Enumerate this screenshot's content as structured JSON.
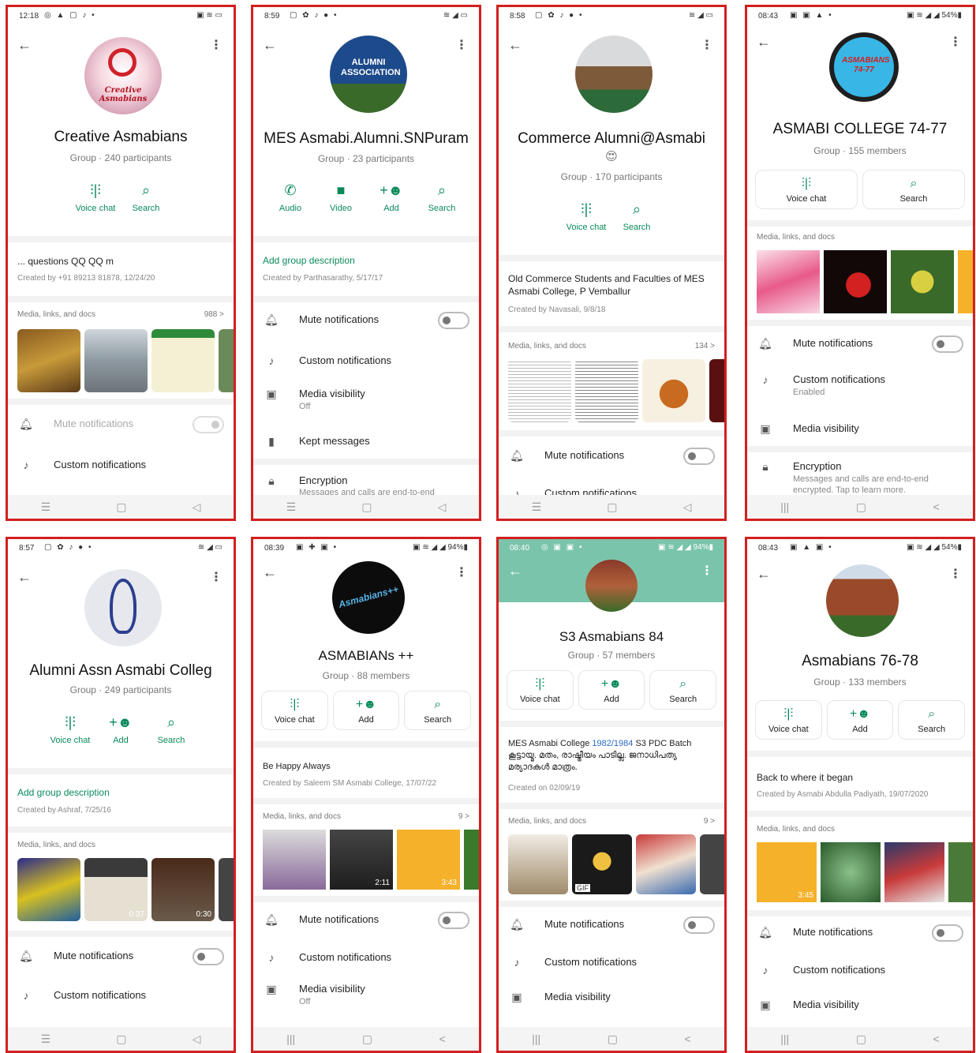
{
  "colors": {
    "accent": "#0a8a5a",
    "frame": "#d31f1f",
    "teal_header": "#7bc4ac"
  },
  "nav": {
    "menu": "☰",
    "home": "▢",
    "back": "◁",
    "recents": "|||",
    "back_alt": "<"
  },
  "p1": {
    "status": {
      "time": "12:18",
      "icons": "◎ ▲ ▢ ♪ •",
      "right": "▣ ≋ ▭"
    },
    "name": "Creative Asmabians",
    "sub": "Group · 240 participants",
    "avatar_text": "Creative Asmabians",
    "act1": "Voice chat",
    "act2": "Search",
    "desc": "... questions QQ QQ m",
    "created": "Created by +91 89213 81878, 12/24/20",
    "media": "Media, links, and docs",
    "count": "988 >",
    "mute": "Mute notifications",
    "custom": "Custom notifications"
  },
  "p2": {
    "status": {
      "time": "8:59",
      "icons": "▢ ✿ ♪ ● •",
      "right": "≋ ◢ ▭"
    },
    "name": "MES Asmabi.Alumni.SNPuram",
    "sub": "Group · 23 participants",
    "avatar_text": "ALUMNI ASSOCIATION",
    "act1": "Audio",
    "act2": "Video",
    "act3": "Add",
    "act4": "Search",
    "adddesc": "Add group description",
    "created": "Created by Parthasarathy, 5/17/17",
    "mute": "Mute notifications",
    "custom": "Custom notifications",
    "mediavis": "Media visibility",
    "off": "Off",
    "kept": "Kept messages",
    "enc": "Encryption",
    "enc_sub": "Messages and calls are end-to-end"
  },
  "p3": {
    "status": {
      "time": "8:58",
      "icons": "▢ ✿ ♪ ● •",
      "right": "≋ ◢ ▭"
    },
    "name": "Commerce Alumni@Asmabi",
    "emoji": "😍",
    "sub": "Group · 170 participants",
    "act1": "Voice chat",
    "act2": "Search",
    "desc": "Old Commerce Students and Faculties of MES Asmabi College, P Vemballur",
    "created": "Created by Navasali, 9/8/18",
    "media": "Media, links, and docs",
    "count": "134 >",
    "mute": "Mute notifications",
    "custom": "Custom notifications"
  },
  "p4": {
    "status": {
      "time": "08:43",
      "icons": "▣ ▣ ▲ •",
      "right": "▣ ≋ ◢ ◢ 54%▮"
    },
    "name": "ASMABI COLLEGE 74-77",
    "sub": "Group · 155 members",
    "avatar_text": "ASMABIANS 74-77",
    "act1": "Voice chat",
    "act2": "Search",
    "media": "Media, links, and docs",
    "mute": "Mute notifications",
    "custom": "Custom notifications",
    "enabled": "Enabled",
    "mediavis": "Media visibility",
    "enc": "Encryption",
    "enc_sub": "Messages and calls are end-to-end encrypted. Tap to learn more."
  },
  "p5": {
    "status": {
      "time": "8:57",
      "icons": "▢ ✿ ♪ ● •",
      "right": "≋ ◢ ▭"
    },
    "name": "Alumni Assn Asmabi Colleg",
    "sub": "Group · 249 participants",
    "act1": "Voice chat",
    "act2": "Add",
    "act3": "Search",
    "adddesc": "Add group description",
    "created": "Created by Ashraf, 7/25/16",
    "media": "Media, links, and docs",
    "dur1": "0:37",
    "dur2": "0:30",
    "mute": "Mute notifications",
    "custom": "Custom notifications"
  },
  "p6": {
    "status": {
      "time": "08:39",
      "icons": "▣ ✚ ▣ •",
      "right": "▣ ≋ ◢ ◢ 94%▮"
    },
    "name": "ASMABIANs ++",
    "sub": "Group · 88 members",
    "avatar_text": "Asmabians++",
    "act1": "Voice chat",
    "act2": "Add",
    "act3": "Search",
    "desc": "Be Happy Always",
    "created": "Created by Saleem SM Asmabi College, 17/07/22",
    "media": "Media, links, and docs",
    "count": "9 >",
    "dur1": "2:11",
    "dur2": "3:43",
    "mute": "Mute notifications",
    "custom": "Custom notifications",
    "mediavis": "Media visibility",
    "off": "Off"
  },
  "p7": {
    "status": {
      "time": "08:40",
      "icons": "◎ ▣ ▣ •",
      "right": "▣ ≋ ◢ ◢ 94%▮"
    },
    "name": "S3 Asmabians 84",
    "sub": "Group · 57 members",
    "act1": "Voice chat",
    "act2": "Add",
    "act3": "Search",
    "desc_a": "MES Asmabi College ",
    "desc_link": "1982/1984",
    "desc_b": " S3 PDC Batch",
    "desc2": "കൂട്ടായ്മ. മതം, രാഷ്ട്രീയം പാടില്ല. ജനാധിപത്യ മര്യാദകൾ മാത്രം.",
    "created": "Created on 02/09/19",
    "media": "Media, links, and docs",
    "count": "9 >",
    "gif": "GIF",
    "mute": "Mute notifications",
    "custom": "Custom notifications",
    "mediavis": "Media visibility"
  },
  "p8": {
    "status": {
      "time": "08:43",
      "icons": "▣ ▲ ▣ •",
      "right": "▣ ≋ ◢ ◢ 54%▮"
    },
    "name": "Asmabians 76-78",
    "sub": "Group · 133 members",
    "act1": "Voice chat",
    "act2": "Add",
    "act3": "Search",
    "desc": "Back to where it began",
    "created": "Created by Asmabi Abdulla Padiyath, 19/07/2020",
    "media": "Media, links, and docs",
    "dur1": "3:45",
    "mute": "Mute notifications",
    "custom": "Custom notifications",
    "mediavis": "Media visibility"
  }
}
